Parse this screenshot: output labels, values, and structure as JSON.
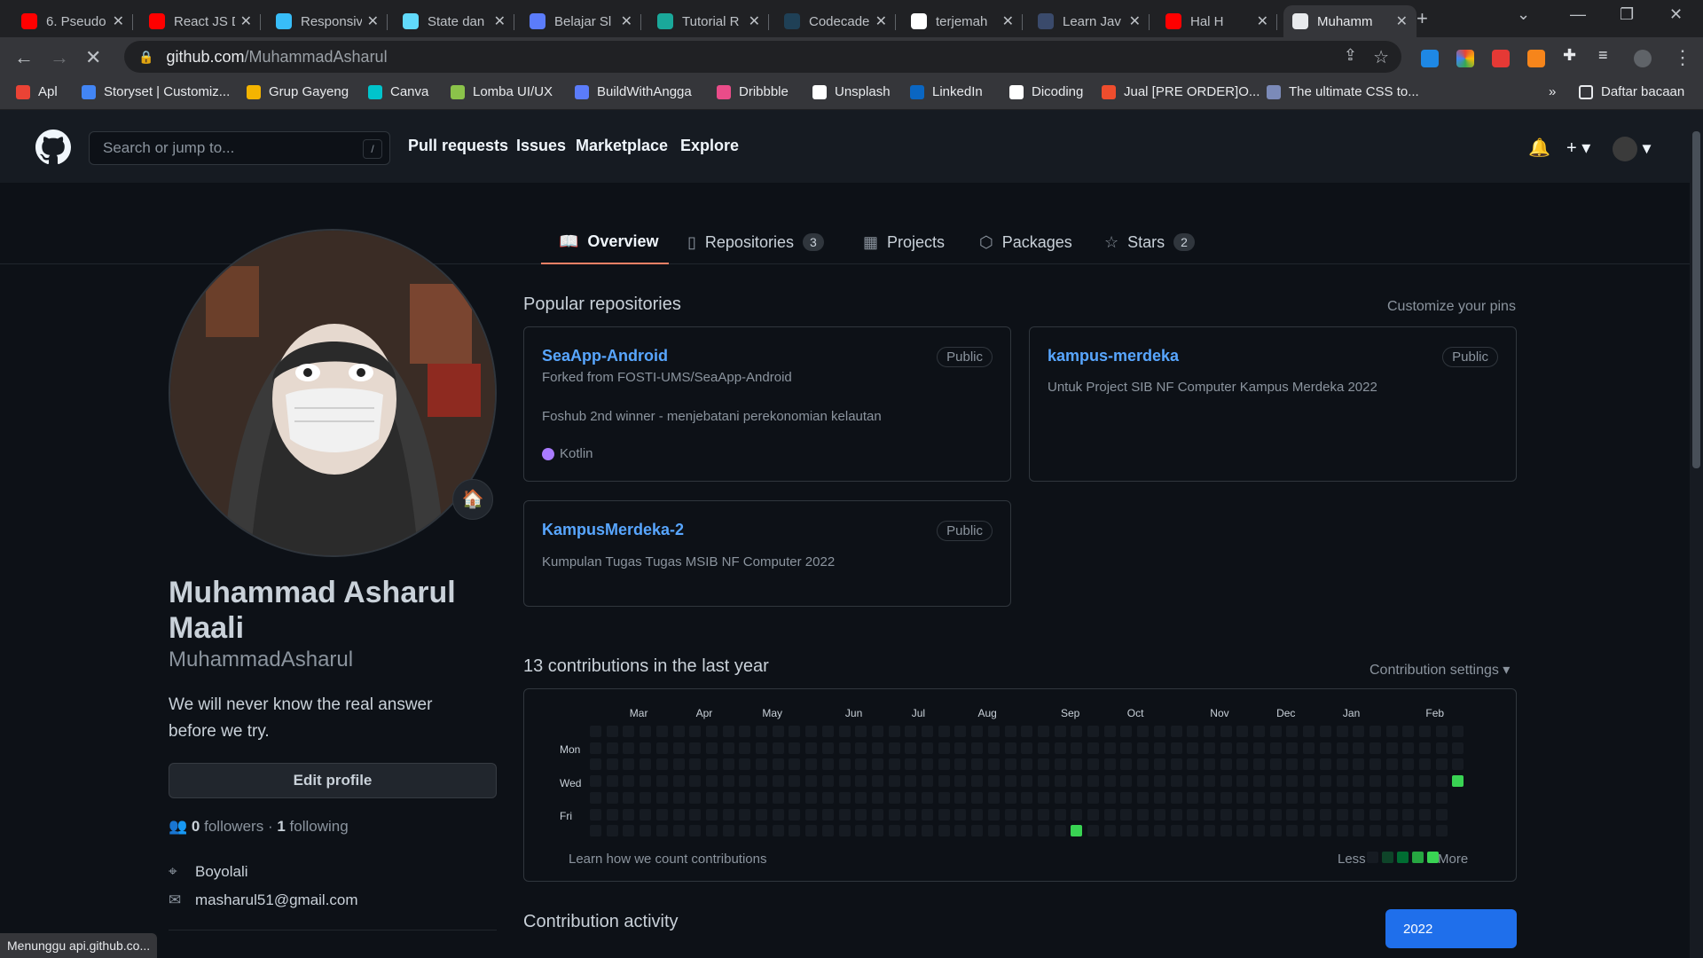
{
  "browser": {
    "tabs": [
      {
        "label": "6. Pseudo",
        "color": "#ff0000"
      },
      {
        "label": "React JS D",
        "color": "#ff0000"
      },
      {
        "label": "Responsiv",
        "color": "#38bdf8"
      },
      {
        "label": "State dan",
        "color": "#61dafb"
      },
      {
        "label": "Belajar Sl",
        "color": "#5b7cfa"
      },
      {
        "label": "Tutorial R",
        "color": "#1aa89a"
      },
      {
        "label": "Codecade",
        "color": "#1f4056"
      },
      {
        "label": "terjemah",
        "color": "#ffffff"
      },
      {
        "label": "Learn Jav",
        "color": "#3a4a6b"
      },
      {
        "label": "Hal H",
        "color": "#ff0000"
      },
      {
        "label": "Muhamm",
        "color": "#e8eaed"
      }
    ],
    "url_host": "github.com",
    "url_path": "/MuhammadAsharul",
    "bookmarks": [
      {
        "label": "Apl",
        "color": "#ea4335"
      },
      {
        "label": "Storyset | Customiz...",
        "color": "#4285f4"
      },
      {
        "label": "Grup Gayeng",
        "color": "#f4b400"
      },
      {
        "label": "Canva",
        "color": "#00c4cc"
      },
      {
        "label": "Lomba UI/UX",
        "color": "#8bc34a"
      },
      {
        "label": "BuildWithAngga",
        "color": "#5b7cfa"
      },
      {
        "label": "Dribbble",
        "color": "#ea4c89"
      },
      {
        "label": "Unsplash",
        "color": "#ffffff"
      },
      {
        "label": "LinkedIn",
        "color": "#0a66c2"
      },
      {
        "label": "Dicoding",
        "color": "#ffffff"
      },
      {
        "label": "Jual [PRE ORDER]O...",
        "color": "#ee4d2d"
      },
      {
        "label": "The ultimate CSS to...",
        "color": "#7b8ab8"
      }
    ],
    "bookmarks_more": "»",
    "reading_list": "Daftar bacaan",
    "status_text": "Menunggu api.github.co..."
  },
  "header": {
    "search_placeholder": "Search or jump to...",
    "search_key": "/",
    "links": [
      "Pull requests",
      "Issues",
      "Marketplace",
      "Explore"
    ]
  },
  "profile_tabs": [
    {
      "label": "Overview",
      "icon": "book-icon",
      "count": ""
    },
    {
      "label": "Repositories",
      "icon": "repo-icon",
      "count": "3"
    },
    {
      "label": "Projects",
      "icon": "table-icon",
      "count": ""
    },
    {
      "label": "Packages",
      "icon": "package-icon",
      "count": ""
    },
    {
      "label": "Stars",
      "icon": "star-icon",
      "count": "2"
    }
  ],
  "profile": {
    "name": "Muhammad Asharul Maali",
    "login": "MuhammadAsharul",
    "bio": "We will never know the real answer before we try.",
    "edit_button": "Edit profile",
    "followers_count": "0",
    "followers_label": "followers",
    "separator": "·",
    "following_count": "1",
    "following_label": "following",
    "location": "Boyolali",
    "email": "masharul51@gmail.com",
    "status_emoji": "🏠"
  },
  "popular": {
    "title": "Popular repositories",
    "customize": "Customize your pins",
    "repos": [
      {
        "name": "SeaApp-Android",
        "visibility": "Public",
        "forked": "Forked from FOSTI-UMS/SeaApp-Android",
        "description": "Foshub 2nd winner - menjebatani perekonomian kelautan",
        "language": "Kotlin",
        "language_color": "#a97bff"
      },
      {
        "name": "kampus-merdeka",
        "visibility": "Public",
        "forked": "",
        "description": "Untuk Project SIB NF Computer Kampus Merdeka 2022",
        "language": "",
        "language_color": ""
      },
      {
        "name": "KampusMerdeka-2",
        "visibility": "Public",
        "forked": "",
        "description": "Kumpulan Tugas Tugas MSIB NF Computer 2022",
        "language": "",
        "language_color": ""
      }
    ]
  },
  "contributions": {
    "title": "13 contributions in the last year",
    "settings": "Contribution settings ▾",
    "months": [
      "Mar",
      "Apr",
      "May",
      "Jun",
      "Jul",
      "Aug",
      "Sep",
      "Oct",
      "Nov",
      "Dec",
      "Jan",
      "Feb"
    ],
    "days": [
      "Mon",
      "Wed",
      "Fri"
    ],
    "learn": "Learn how we count contributions",
    "less": "Less",
    "more": "More",
    "empty_color": "#161b22",
    "levels": [
      "#161b22",
      "#0e4429",
      "#006d32",
      "#26a641",
      "#39d353"
    ],
    "active_cells": [
      {
        "week": 29,
        "day": 6,
        "level": 4
      },
      {
        "week": 52,
        "day": 3,
        "level": 4
      }
    ]
  },
  "activity": {
    "title": "Contribution activity",
    "year": "2022"
  }
}
